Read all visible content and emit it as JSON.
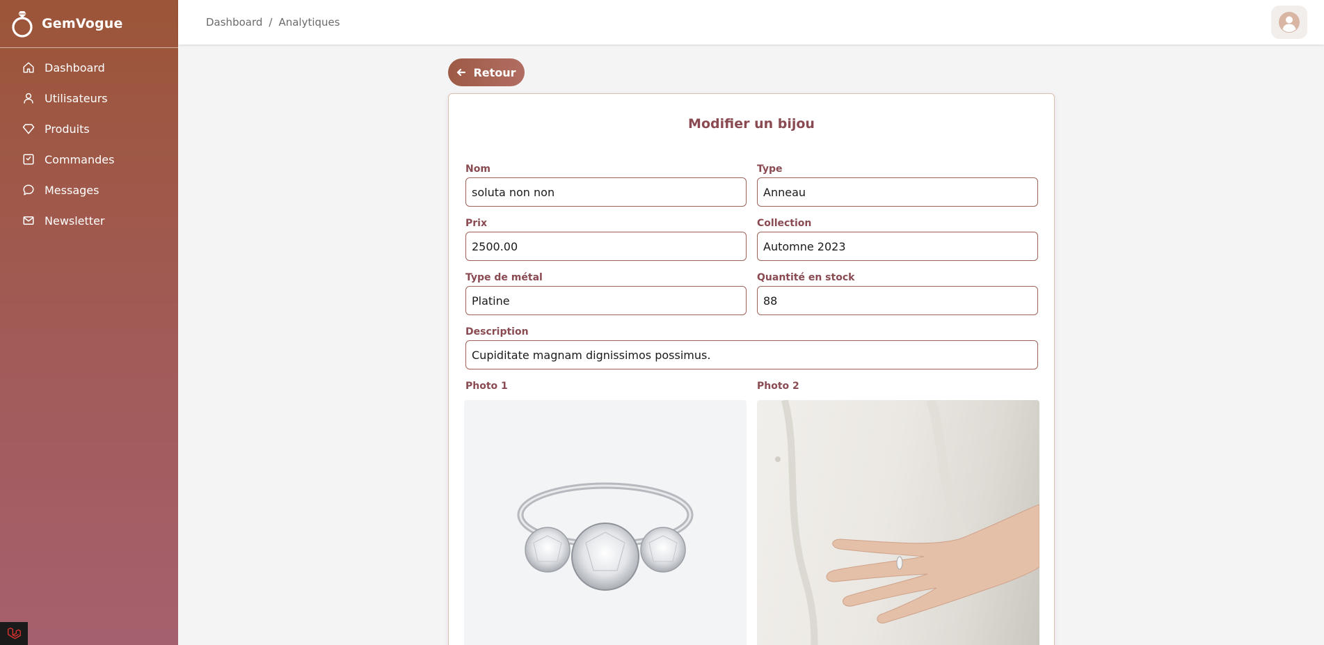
{
  "brand": {
    "name": "GemVogue"
  },
  "sidebar": {
    "items": [
      {
        "label": "Dashboard",
        "icon": "home-icon"
      },
      {
        "label": "Utilisateurs",
        "icon": "user-icon"
      },
      {
        "label": "Produits",
        "icon": "diamond-icon"
      },
      {
        "label": "Commandes",
        "icon": "order-icon"
      },
      {
        "label": "Messages",
        "icon": "chat-icon"
      },
      {
        "label": "Newsletter",
        "icon": "mail-icon"
      }
    ]
  },
  "breadcrumb": {
    "root": "Dashboard",
    "separator": "/",
    "current": "Analytiques"
  },
  "back_button": {
    "label": "Retour"
  },
  "form": {
    "title": "Modifier un bijou",
    "nom": {
      "label": "Nom",
      "value": "soluta non non"
    },
    "type": {
      "label": "Type",
      "value": "Anneau"
    },
    "prix": {
      "label": "Prix",
      "value": "2500.00"
    },
    "collection": {
      "label": "Collection",
      "value": "Automne 2023"
    },
    "metal": {
      "label": "Type de métal",
      "value": "Platine"
    },
    "stock": {
      "label": "Quantité en stock",
      "value": "88"
    },
    "description": {
      "label": "Description",
      "value": "Cupiditate magnam dignissimos possimus."
    },
    "photo1": {
      "label": "Photo 1"
    },
    "photo2": {
      "label": "Photo 2"
    }
  },
  "colors": {
    "accent": "#8a4a52",
    "sidebar_top": "#9c5538",
    "sidebar_bottom": "#a5606e",
    "border": "#9c6258"
  }
}
